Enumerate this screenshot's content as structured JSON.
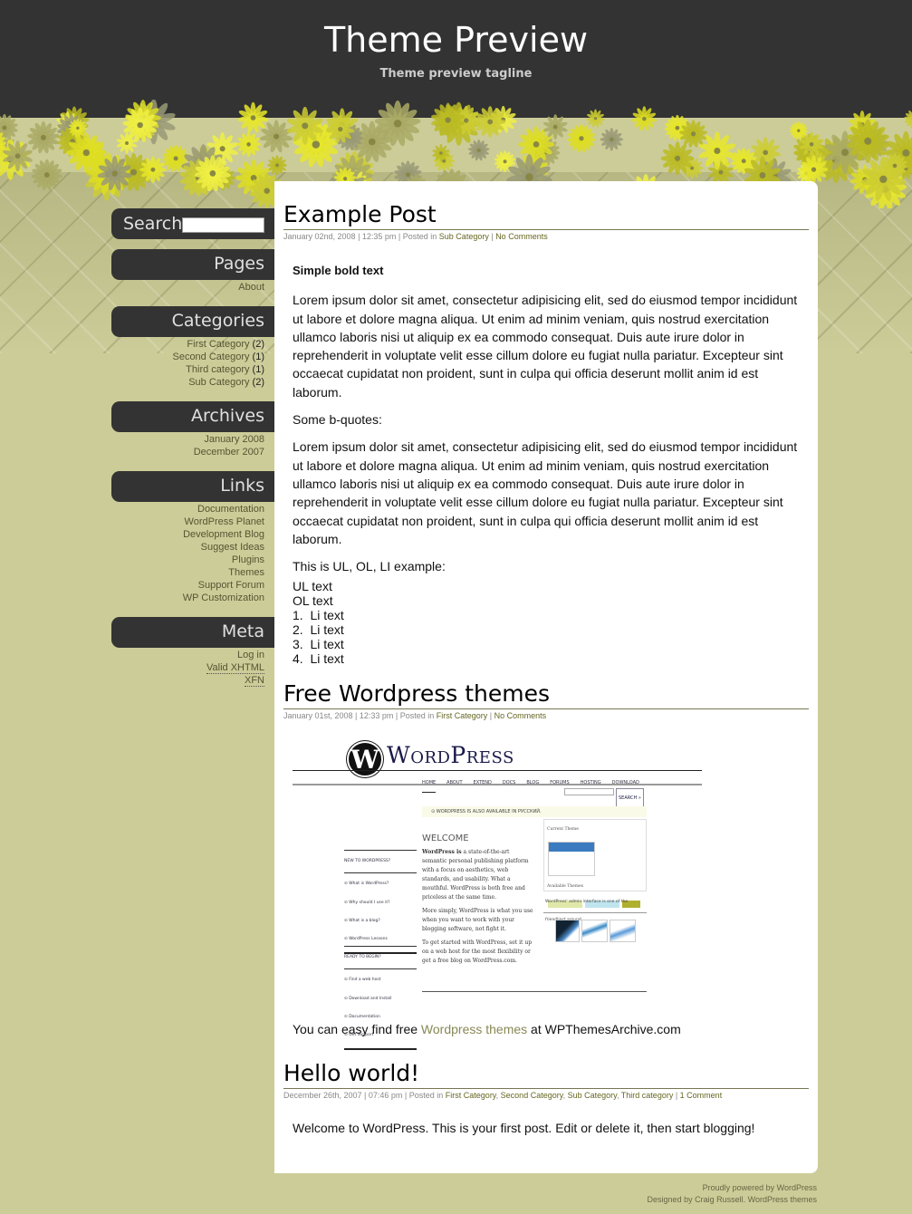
{
  "header": {
    "title": "Theme Preview",
    "tagline": "Theme preview tagline"
  },
  "colors": {
    "header_bg": "#333333",
    "page_bg": "#cccc99",
    "accent_link": "#666622",
    "flower": "#dddd22"
  },
  "sidebar": {
    "search": {
      "label": "Search",
      "value": "",
      "placeholder": ""
    },
    "pages": {
      "title": "Pages",
      "items": [
        {
          "label": "About"
        }
      ]
    },
    "categories": {
      "title": "Categories",
      "items": [
        {
          "label": "First Category",
          "count": "(2)"
        },
        {
          "label": "Second Category",
          "count": "(1)"
        },
        {
          "label": "Third category",
          "count": "(1)"
        },
        {
          "label": "Sub Category",
          "count": "(2)"
        }
      ]
    },
    "archives": {
      "title": "Archives",
      "items": [
        {
          "label": "January 2008"
        },
        {
          "label": "December 2007"
        }
      ]
    },
    "links": {
      "title": "Links",
      "items": [
        {
          "label": "Documentation"
        },
        {
          "label": "WordPress Planet"
        },
        {
          "label": "Development Blog"
        },
        {
          "label": "Suggest Ideas"
        },
        {
          "label": "Plugins"
        },
        {
          "label": "Themes"
        },
        {
          "label": "Support Forum"
        },
        {
          "label": "WP Customization"
        }
      ]
    },
    "meta": {
      "title": "Meta",
      "items": [
        {
          "label": "Log in"
        },
        {
          "label": "Valid XHTML"
        },
        {
          "label": "XFN"
        }
      ]
    }
  },
  "posts": [
    {
      "title": "Example Post",
      "meta_prefix": "January 02nd, 2008 | 12:35 pm | Posted in ",
      "categories": [
        "Sub Category"
      ],
      "comments": "No Comments",
      "bold": "Simple bold text",
      "para1": "Lorem ipsum dolor sit amet, consectetur adipisicing elit, sed do eiusmod tempor incididunt ut labore et dolore magna aliqua. Ut enim ad minim veniam, quis nostrud exercitation ullamco laboris nisi ut aliquip ex ea commodo consequat. Duis aute irure dolor in reprehenderit in voluptate velit esse cillum dolore eu fugiat nulla pariatur. Excepteur sint occaecat cupidatat non proident, sunt in culpa qui officia deserunt mollit anim id est laborum.",
      "bquote_label": "Some b-quotes:",
      "para2": "Lorem ipsum dolor sit amet, consectetur adipisicing elit, sed do eiusmod tempor incididunt ut labore et dolore magna aliqua. Ut enim ad minim veniam, quis nostrud exercitation ullamco laboris nisi ut aliquip ex ea commodo consequat. Duis aute irure dolor in reprehenderit in voluptate velit esse cillum dolore eu fugiat nulla pariatur. Excepteur sint occaecat cupidatat non proident, sunt in culpa qui officia deserunt mollit anim id est laborum.",
      "list_label": "This is UL, OL, LI example:",
      "ul_text": "UL text",
      "ol_text": "OL text",
      "li_items": [
        "1.  Li text",
        "2.  Li text",
        "3.  Li text",
        "4.  Li text"
      ]
    },
    {
      "title": "Free Wordpress themes",
      "meta_prefix": "January 01st, 2008 | 12:33 pm | Posted in ",
      "categories": [
        "First Category"
      ],
      "comments": "No Comments",
      "text_before": "You can easy find free ",
      "link": "Wordpress themes",
      "text_after": " at WPThemesArchive.com",
      "screenshot": {
        "logo": "WordPress",
        "nav": [
          "HOME",
          "ABOUT",
          "EXTEND",
          "DOCS",
          "BLOG",
          "FORUMS",
          "HOSTING",
          "DOWNLOAD"
        ],
        "search_button": "SEARCH »",
        "notice": "WORDPRESS IS ALSO AVAILABLE IN РУССКИЙ.",
        "welcome": "WELCOME",
        "new_heading": "NEW TO WORDPRESS?",
        "new_items": [
          "What is WordPress?",
          "Why should I use it?",
          "What is a blog?",
          "WordPress Lessons"
        ],
        "ready_heading": "READY TO BEGIN?",
        "ready_items": [
          "Find a web host",
          "Download and Install",
          "Documentation",
          "Get Support"
        ],
        "intro_bold": "WordPress is",
        "intro": " a state-of-the-art semantic personal publishing platform with a focus on aesthetics, web standards, and usability. What a mouthful. WordPress is both free and priceless at the same time.",
        "simply": "More simply, WordPress is what you use when you want to work with your blogging software, not fight it.",
        "started": "To get started with WordPress, set it up on a web host for the most flexibility or get a free blog on WordPress.com.",
        "current_theme": "Current Theme",
        "available_themes": "Available Themes",
        "caption": "WordPress' admin interface is one of the friendliest around."
      }
    },
    {
      "title": "Hello world!",
      "meta_prefix": "December 26th, 2007 | 07:46 pm | Posted in ",
      "categories": [
        "First Category",
        "Second Category",
        "Sub Category",
        "Third category"
      ],
      "comments": "1 Comment",
      "body": "Welcome to WordPress. This is your first post. Edit or delete it, then start blogging!"
    }
  ],
  "footer": {
    "line1": "Proudly powered by WordPress",
    "line2_prefix": "Designed by ",
    "designer": "Craig Russell",
    "line2_sep": ". ",
    "themes_link": "WordPress themes"
  }
}
